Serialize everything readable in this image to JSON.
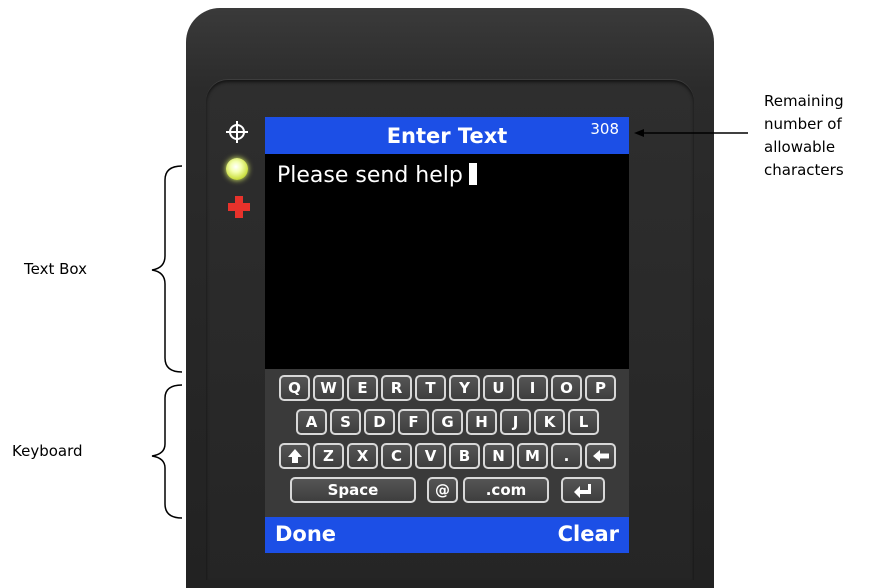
{
  "screen": {
    "title": "Enter Text",
    "remaining_count": "308",
    "text_value": "Please send help"
  },
  "keyboard": {
    "row1": [
      "Q",
      "W",
      "E",
      "R",
      "T",
      "Y",
      "U",
      "I",
      "O",
      "P"
    ],
    "row2": [
      "A",
      "S",
      "D",
      "F",
      "G",
      "H",
      "J",
      "K",
      "L"
    ],
    "row3": [
      "Z",
      "X",
      "C",
      "V",
      "B",
      "N",
      "M",
      "."
    ],
    "row4": {
      "space": "Space",
      "at": "@",
      "dotcom": ".com"
    }
  },
  "soft_keys": {
    "left": "Done",
    "right": "Clear"
  },
  "annotations": {
    "remaining": [
      "Remaining",
      "number of",
      "allowable",
      "characters"
    ],
    "text_box": "Text Box",
    "keyboard": "Keyboard"
  },
  "icons": {
    "crosshair": "crosshair-icon",
    "status_led": "status-led-icon",
    "plus": "red-plus-icon",
    "shift": "shift-arrow-icon",
    "backspace": "backspace-arrow-icon",
    "enter": "enter-arrow-icon"
  },
  "colors": {
    "accent_blue": "#1c4fe6",
    "led_green": "#cfe24a",
    "plus_red": "#e8322b"
  }
}
